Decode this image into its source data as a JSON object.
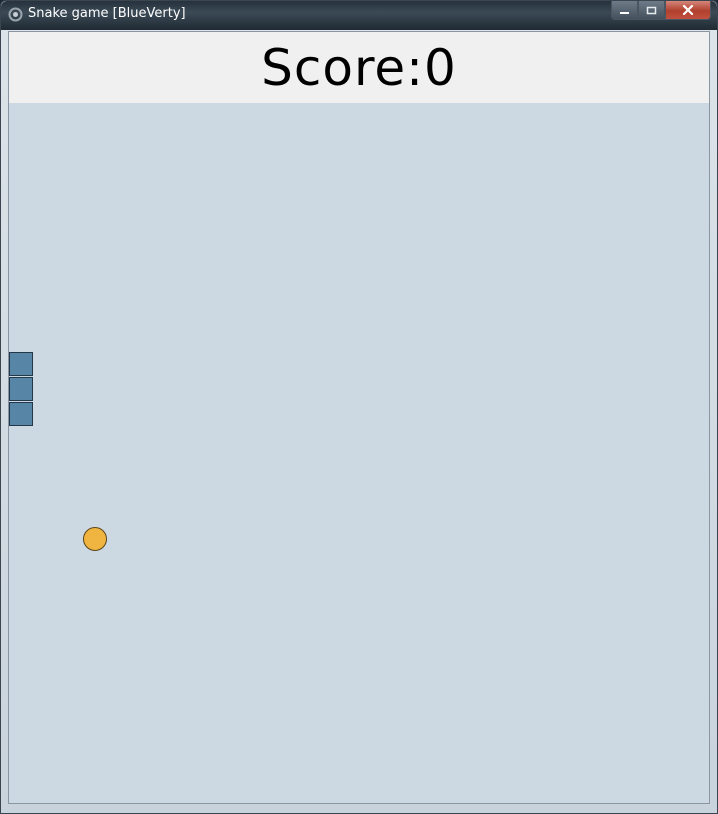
{
  "window": {
    "title": "Snake game [BlueVerty]",
    "icon": "app-icon",
    "controls": [
      "minimize-icon",
      "maximize-icon",
      "close-icon"
    ]
  },
  "score": {
    "text": "Score:0",
    "value": 0
  },
  "colors": {
    "board": "#cdd9e2",
    "score_bar": "#f0f0f0",
    "snake": "#5785a6",
    "food": "#f0b440"
  }
}
